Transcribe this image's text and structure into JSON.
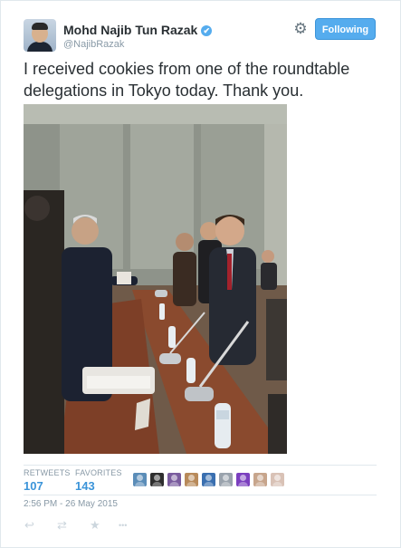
{
  "user": {
    "name": "Mohd Najib Tun Razak",
    "handle": "@NajibRazak",
    "verified_mark": "✔"
  },
  "header": {
    "gear_glyph": "⚙",
    "follow_label": "Following"
  },
  "tweet": {
    "text": "I received cookies from one of the roundtable delegations in Tokyo today. Thank you."
  },
  "stats": {
    "retweets_label": "RETWEETS",
    "retweets_count": "107",
    "favorites_label": "FAVORITES",
    "favorites_count": "143"
  },
  "favoriters": [
    {
      "icon": "avatar-1",
      "color": "#5b8db8"
    },
    {
      "icon": "avatar-2",
      "color": "#2e2e2e"
    },
    {
      "icon": "avatar-3",
      "color": "#7a5c9e"
    },
    {
      "icon": "avatar-4",
      "color": "#b88a5a"
    },
    {
      "icon": "avatar-5",
      "color": "#3a6fb0"
    },
    {
      "icon": "avatar-6",
      "color": "#9aa3ad"
    },
    {
      "icon": "avatar-7",
      "color": "#7b3fbf"
    },
    {
      "icon": "avatar-8",
      "color": "#c7a58c"
    },
    {
      "icon": "avatar-9",
      "color": "#d9c2b6"
    }
  ],
  "timestamp": "2:56 PM - 26 May 2015",
  "actions": {
    "reply_glyph": "↩",
    "retweet_glyph": "⇄",
    "favorite_glyph": "★",
    "more_glyph": "•••"
  },
  "colors": {
    "accent": "#55acee",
    "link": "#3b94d9",
    "muted": "#8899a6"
  }
}
